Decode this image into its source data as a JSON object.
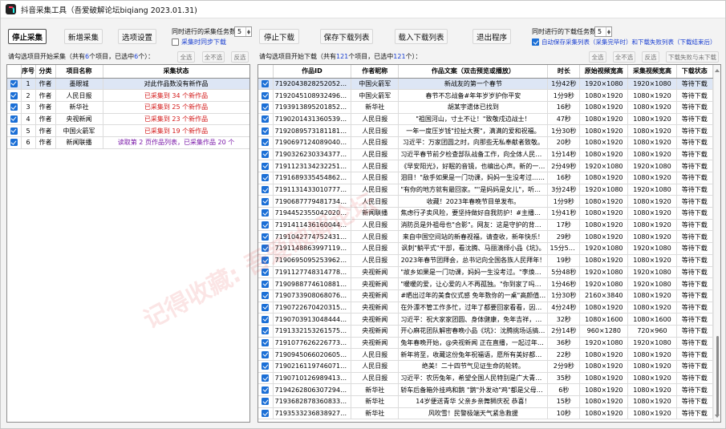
{
  "app": {
    "title": "抖音采集工具（吾爱破解论坛biqiang 2023.01.31)"
  },
  "toolbar": {
    "stop_collect": "停止采集",
    "add_collect": "新增采集",
    "settings": "选项设置",
    "concurrent_collect_label": "同时进行的采集任务数",
    "concurrent_collect_value": "5",
    "sync_download_label": "采集时同步下载",
    "stop_download": "停止下载",
    "save_download_list": "保存下载列表",
    "load_download_list": "载入下载列表",
    "exit": "退出程序",
    "concurrent_download_label": "同时进行的下载任务数",
    "concurrent_download_value": "5",
    "autosave_label": "自动保存采集列表（采集完毕时）和下载失败列表（下载结束后）"
  },
  "left_panel": {
    "header_prefix": "请勾选项目开始采集（共有",
    "header_total": "6",
    "header_mid": "个项目，已选中",
    "header_selected": "6",
    "header_suffix": "个）：",
    "btn_select_all": "全选",
    "btn_select_none": "全不选",
    "btn_invert": "反选",
    "columns": [
      "",
      "序号",
      "分类",
      "项目名称",
      "采集状态"
    ],
    "rows": [
      {
        "no": "1",
        "category": "作者",
        "name": "墨眼城",
        "status": "对此作品数没有新作品",
        "status_color": "normal"
      },
      {
        "no": "2",
        "category": "作者",
        "name": "人民日报",
        "status": "已采集到 34 个新作品",
        "status_color": "red"
      },
      {
        "no": "3",
        "category": "作者",
        "name": "新华社",
        "status": "已采集到 25 个新作品",
        "status_color": "red"
      },
      {
        "no": "4",
        "category": "作者",
        "name": "央视新闻",
        "status": "已采集到 23 个新作品",
        "status_color": "red"
      },
      {
        "no": "5",
        "category": "作者",
        "name": "中国火箭军",
        "status": "已采集到 19 个新作品",
        "status_color": "red"
      },
      {
        "no": "6",
        "category": "作者",
        "name": "新闻联播",
        "status": "读取第 2 页作品列表，已采集作品 20 个",
        "status_color": "purple"
      }
    ]
  },
  "right_panel": {
    "header_prefix": "请勾选项目开始下载（共有",
    "header_total": "121",
    "header_mid": "个项目，已选中",
    "header_selected": "121",
    "header_suffix": "个）：",
    "btn_select_all": "全选",
    "btn_select_none": "全不选",
    "btn_invert": "反选",
    "btn_select_undownloaded": "下载失败与未下载",
    "columns": [
      "",
      "作品ID",
      "作者昵称",
      "作品文案（双击预览或播放）",
      "时长",
      "原始视频宽高",
      "采集视频宽高",
      "下载状态"
    ],
    "rows": [
      {
        "id": "7192043828252052797",
        "author": "中国火箭军",
        "caption": "新战友的第一个春节",
        "duration": "1分42秒",
        "orig": "1920×1080",
        "coll": "1920×1080",
        "state": "等待下载"
      },
      {
        "id": "7192045108932496696",
        "author": "中国火箭军",
        "caption": "春节不忘战备#年年岁岁护你平安",
        "duration": "1分9秒",
        "orig": "1080×1920",
        "coll": "1080×1920",
        "state": "等待下载"
      },
      {
        "id": "7193913895201852733",
        "author": "新华社",
        "caption": "胡某宇遗体已找到",
        "duration": "16秒",
        "orig": "1080×1920",
        "coll": "1080×1920",
        "state": "等待下载"
      },
      {
        "id": "7190201431360539960",
        "author": "人民日报",
        "caption": "\"祖国河山，寸土不让！\"致敬戍边战士！",
        "duration": "47秒",
        "orig": "1080×1920",
        "coll": "1080×1920",
        "state": "等待下载"
      },
      {
        "id": "7192089573181181240",
        "author": "人民日报",
        "caption": "一年一度压岁钱\"拉扯大赛\"，满满的爱和祝福。",
        "duration": "1分30秒",
        "orig": "1080×1920",
        "coll": "1080×1920",
        "state": "等待下载"
      },
      {
        "id": "7190697124089040183",
        "author": "人民日报",
        "caption": "习近平：万家团圆之时，向那些无私奉献者致敬。",
        "duration": "20秒",
        "orig": "1080×1920",
        "coll": "1080×1920",
        "state": "等待下载"
      },
      {
        "id": "7190326230334377274",
        "author": "人民日报",
        "caption": "习近平春节前夕检查部队战备工作，向全体人民解放军指战员、武警",
        "duration": "1分14秒",
        "orig": "1080×1920",
        "coll": "1080×1920",
        "state": "等待下载"
      },
      {
        "id": "7191123134232251685",
        "author": "人民日报",
        "caption": "《早安阳光》，好眠的音镜，也编出心声。新的一年，国泰民安。",
        "duration": "2分49秒",
        "orig": "1920×1080",
        "coll": "1920×1080",
        "state": "等待下载"
      },
      {
        "id": "7191689335454862629",
        "author": "人民日报",
        "caption": "泪目！\"敌手如果是一门功课，妈妈一生没考过……\"",
        "duration": "16秒",
        "orig": "1080×1920",
        "coll": "1080×1920",
        "state": "等待下载"
      },
      {
        "id": "7191131433010777403",
        "author": "人民日报",
        "caption": "\"有你的地方就有最回家。\"\"是妈妈是女儿\"，听哭……",
        "duration": "3分24秒",
        "orig": "1920×1080",
        "coll": "1920×1080",
        "state": "等待下载"
      },
      {
        "id": "7190687779481734461",
        "author": "人民日报",
        "caption": "收藏！2023年春晚节目单发布。",
        "duration": "1分9秒",
        "orig": "1080×1920",
        "coll": "1080×1920",
        "state": "等待下载"
      },
      {
        "id": "7194452355042020642",
        "author": "新闻联播",
        "caption": "焦虑行孑卖风险，要坚持做好自我防护！#主播说联播",
        "duration": "1分41秒",
        "orig": "1080×1920",
        "coll": "1080×1920",
        "state": "等待下载"
      },
      {
        "id": "7191411436160044300",
        "author": "人民日报",
        "caption": "消防员是外祖母也\"合影\"。网友：这是守护的背影！",
        "duration": "17秒",
        "orig": "1080×1920",
        "coll": "1080×1920",
        "state": "等待下载"
      },
      {
        "id": "7191042774752431421",
        "author": "人民日报",
        "caption": "来自中国空间站的新春视福，请查收，新年快乐！",
        "duration": "29秒",
        "orig": "1080×1920",
        "coll": "1080×1920",
        "state": "等待下载"
      },
      {
        "id": "7191148863997119804",
        "author": "人民日报",
        "caption": "讽刺\"躺平式\"干部，看沈腾、马丽演绎小品《坑》。",
        "duration": "15分55秒",
        "orig": "1920×1080",
        "coll": "1920×1080",
        "state": "等待下载"
      },
      {
        "id": "7190695095253962039",
        "author": "人民日报",
        "caption": "2023年春节团拜会，总书记向全国各族人民拜年！",
        "duration": "19秒",
        "orig": "1080×1920",
        "coll": "1080×1920",
        "state": "等待下载"
      },
      {
        "id": "7191127748314778939",
        "author": "央视新闻",
        "caption": "\"故乡如果是一门功课，妈妈一生没考过。\"李焕英、林林俄……",
        "duration": "5分48秒",
        "orig": "1920×1080",
        "coll": "1920×1080",
        "state": "等待下载"
      },
      {
        "id": "7190988774610881853",
        "author": "央视新闻",
        "caption": "\"暖暖的爱，让心爱的人不再孤独。\"你到家了吗？张艺兴担小……",
        "duration": "1分46秒",
        "orig": "1920×1080",
        "coll": "1920×1080",
        "state": "等待下载"
      },
      {
        "id": "7190733908068076857",
        "author": "央视新闻",
        "caption": "#晒出过年的美食仪式感 免年数你的一桌\"高颜值\"花样评，咋……",
        "duration": "1分30秒",
        "orig": "2160×3840",
        "coll": "1080×1920",
        "state": "等待下载"
      },
      {
        "id": "7190722670420315450",
        "author": "央视新闻",
        "caption": "在外漂不管工作多忙，过年了都要回家看看，因为家里有人在等……",
        "duration": "4分24秒",
        "orig": "1080×1920",
        "coll": "1080×1920",
        "state": "等待下载"
      },
      {
        "id": "7190703913048444215",
        "author": "央视新闻",
        "caption": "习近平：祝大家家团圆、身体健康，免年吉祥，万事如意！",
        "duration": "32秒",
        "orig": "1080×1600",
        "coll": "1080×1600",
        "state": "等待下载"
      },
      {
        "id": "7191332153261575482",
        "author": "央视新闻",
        "caption": "开心麻花团队解密春晚小品《坑》：沈腾挑场话搞，但即兴表演……",
        "duration": "2分14秒",
        "orig": "960×1280",
        "coll": "720×960",
        "state": "等待下载"
      },
      {
        "id": "7191077626226773306",
        "author": "央视新闻",
        "caption": "兔年春晚开始，@央视新闻 正在直播，一起过年啦！",
        "duration": "36秒",
        "orig": "1920×1080",
        "coll": "1920×1080",
        "state": "等待下载"
      },
      {
        "id": "7190945066020605241",
        "author": "人民日报",
        "caption": "新年将至，收藏这份兔年祝福语，愿所有美好都如愿而至！",
        "duration": "22秒",
        "orig": "1080×1920",
        "coll": "1080×1920",
        "state": "等待下载"
      },
      {
        "id": "7190216119746071867",
        "author": "人民日报",
        "caption": "绝美！二十四节气见证生命的轮转。",
        "duration": "2分9秒",
        "orig": "1080×1920",
        "coll": "1080×1920",
        "state": "等待下载"
      },
      {
        "id": "7190710126989413691",
        "author": "人民日报",
        "caption": "习近平：农历兔年，希望全国人民特别是广大青年奋动加致兔毅力……",
        "duration": "35秒",
        "orig": "1080×1920",
        "coll": "1080×1920",
        "state": "等待下载"
      },
      {
        "id": "7194262806307294501",
        "author": "新华社",
        "caption": "轿车后备箱外挂鸡和鹅 \"鹅\"外发动\"鸡\"都是父母的爱",
        "duration": "6秒",
        "orig": "1080×1920",
        "coll": "1080×1920",
        "state": "等待下载"
      },
      {
        "id": "7193682878360833340",
        "author": "新华社",
        "caption": "14岁便送青华 父亲乡亲舞狮庆祝 恭喜！",
        "duration": "15秒",
        "orig": "1080×1920",
        "coll": "1080×1920",
        "state": "等待下载"
      },
      {
        "id": "7193533236838927671",
        "author": "新华社",
        "caption": "风吹雪！民警极端天气紧急救援",
        "duration": "10秒",
        "orig": "1080×1920",
        "coll": "1080×1920",
        "state": "等待下载"
      }
    ]
  },
  "watermark": {
    "text": "记得收藏: 吾爱破解论坛"
  }
}
